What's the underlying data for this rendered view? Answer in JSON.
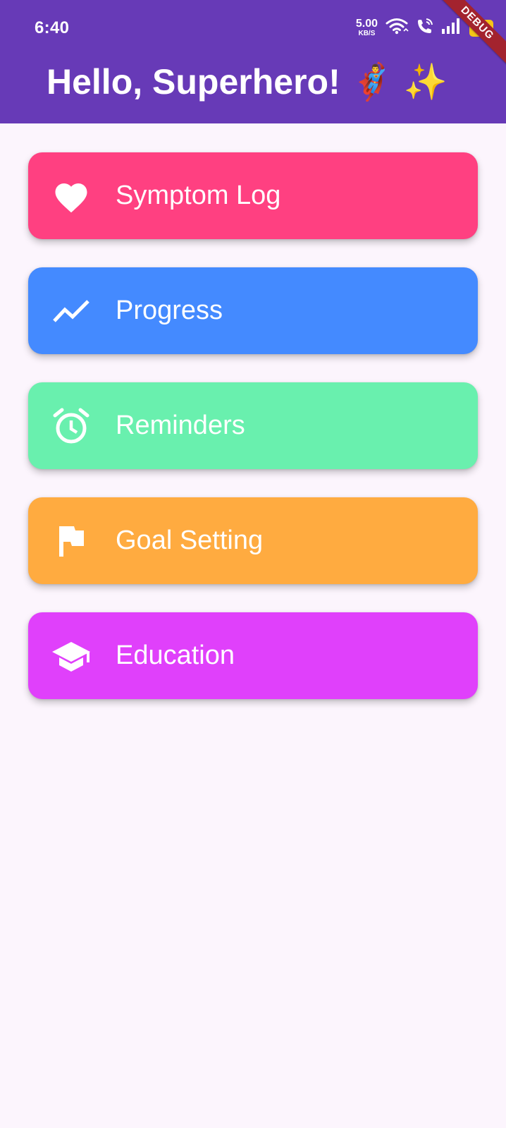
{
  "status_bar": {
    "time": "6:40",
    "net_speed_value": "5.00",
    "net_speed_unit": "KB/S",
    "battery": "50",
    "icons": [
      "wifi-icon",
      "wifi-call-icon",
      "signal-icon",
      "battery-icon"
    ]
  },
  "app_bar": {
    "title": "Hello, Superhero! 🦸‍♂️ ✨",
    "background_color": "#673ab7"
  },
  "debug_banner": {
    "label": "DEBUG"
  },
  "menu": {
    "items": [
      {
        "label": "Symptom Log",
        "icon": "heart-icon",
        "color": "#ff4081"
      },
      {
        "label": "Progress",
        "icon": "trending-up-icon",
        "color": "#448aff"
      },
      {
        "label": "Reminders",
        "icon": "alarm-clock-icon",
        "color": "#69f0ae"
      },
      {
        "label": "Goal Setting",
        "icon": "flag-icon",
        "color": "#ffab40"
      },
      {
        "label": "Education",
        "icon": "graduation-cap-icon",
        "color": "#e040fb"
      }
    ]
  }
}
